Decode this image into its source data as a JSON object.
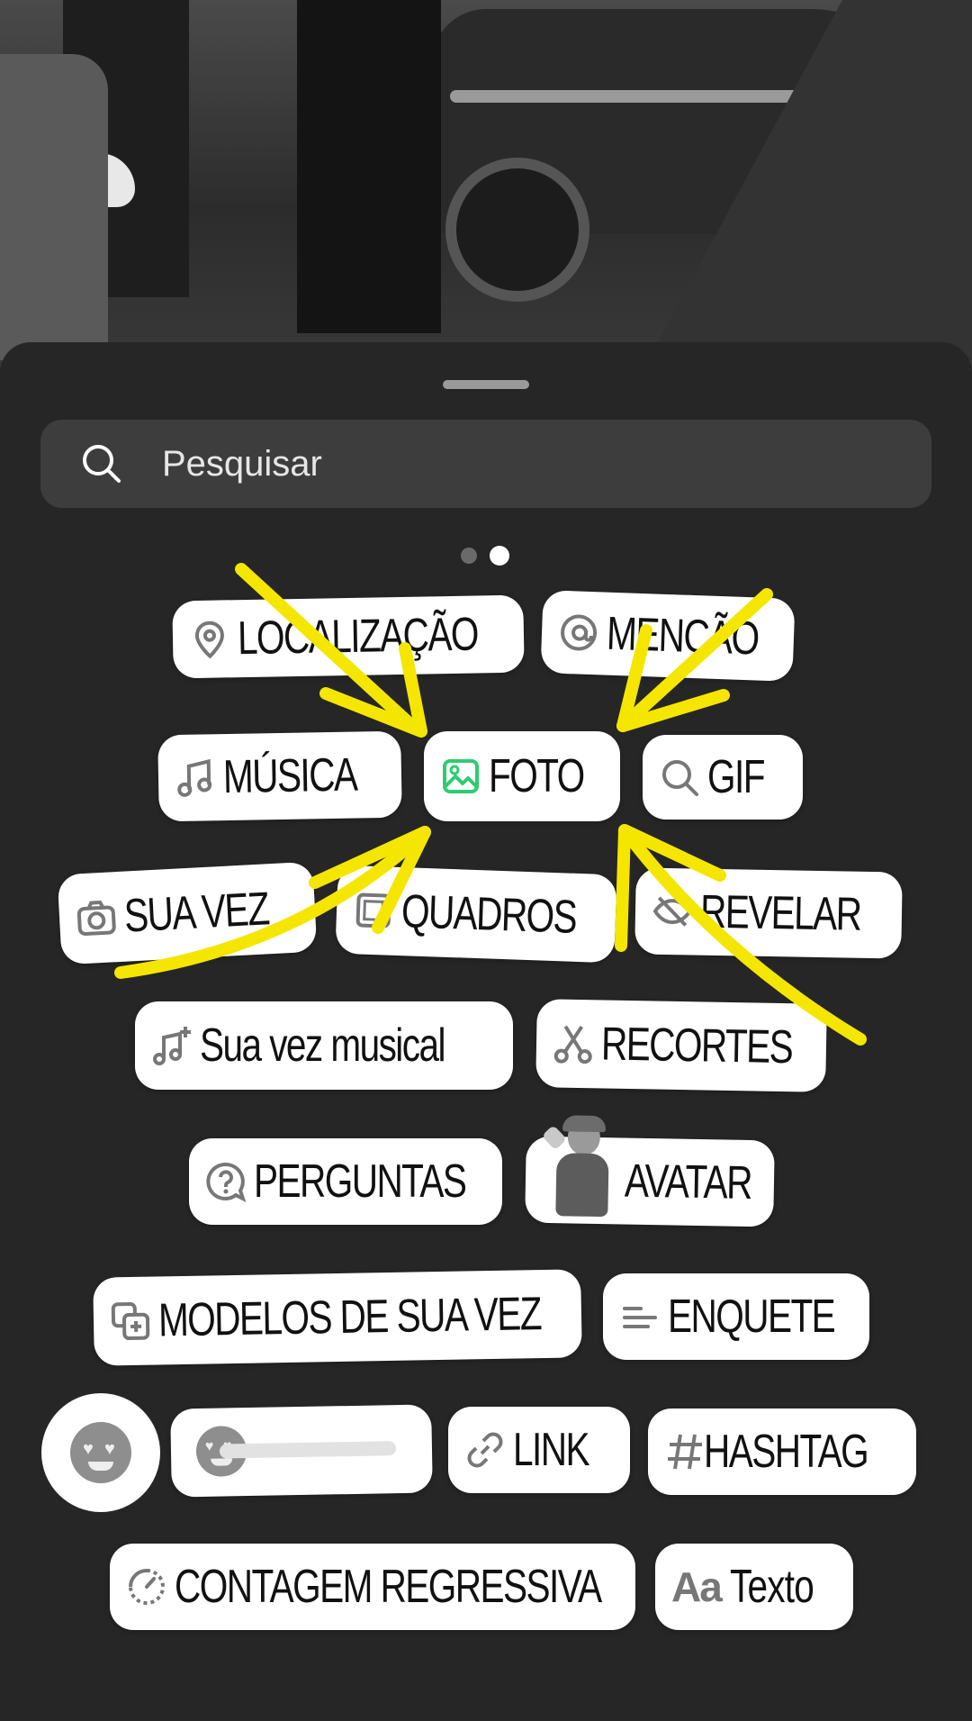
{
  "search": {
    "placeholder": "Pesquisar"
  },
  "pager": {
    "pages": 2,
    "active": 2
  },
  "stickers": {
    "location": "LOCALIZAÇÃO",
    "mention": "MENÇÃO",
    "music": "MÚSICA",
    "photo": "FOTO",
    "gif": "GIF",
    "your_turn": "SUA VEZ",
    "frames": "QUADROS",
    "reveal": "REVELAR",
    "your_turn_music": "Sua vez musical",
    "cutouts": "RECORTES",
    "questions": "PERGUNTAS",
    "avatar": "AVATAR",
    "your_turn_templates": "MODELOS DE SUA VEZ",
    "poll": "ENQUETE",
    "link": "LINK",
    "hashtag": "HASHTAG",
    "countdown": "CONTAGEM REGRESSIVA",
    "text": "Texto",
    "text_icon": "Aa"
  },
  "colors": {
    "sheet": "#262626",
    "search_bg": "#3d3d3d",
    "photo_icon": "#2ecc71",
    "annotation_arrows": "#f5e600"
  }
}
